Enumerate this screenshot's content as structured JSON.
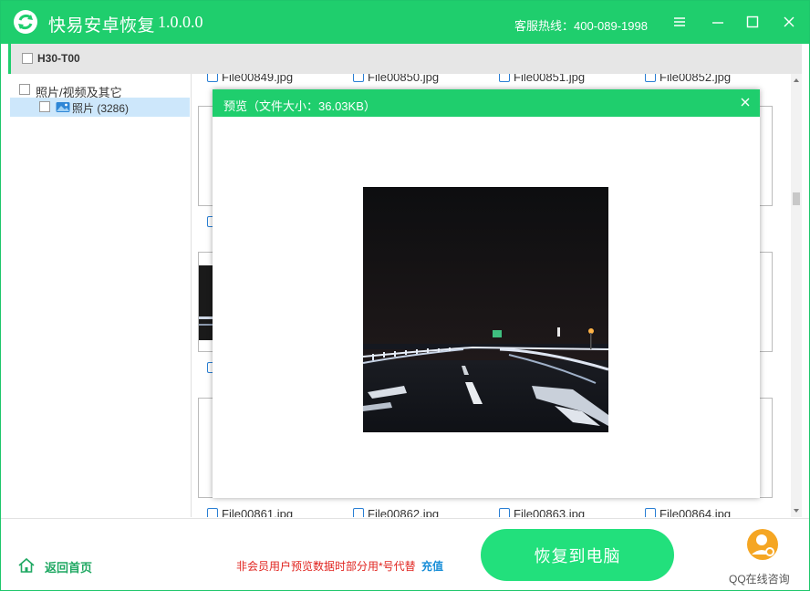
{
  "app": {
    "name": "快易安卓恢复",
    "version": "1.0.0.0",
    "hotline": "客服热线：400-089-1998"
  },
  "colors": {
    "brand": "#1fce6d",
    "button": "#22e07c",
    "notice": "#e0241f",
    "link": "#1a8fd8"
  },
  "device": {
    "name": "H30-T00"
  },
  "tree": {
    "root_label": "照片/视频及其它",
    "child_label": "照片 (3286)"
  },
  "grid": {
    "top_files": [
      "File00849.jpg",
      "File00850.jpg",
      "File00851.jpg",
      "File00852.jpg"
    ],
    "bottom_files": [
      "File00861.jpg",
      "File00862.jpg",
      "File00863.jpg",
      "File00864.jpg"
    ]
  },
  "preview": {
    "title": "预览（文件大小：36.03KB）"
  },
  "bottom": {
    "home_label": "返回首页",
    "notice": "非会员用户预览数据时部分用*号代替",
    "recharge": "充值",
    "recover_button": "恢复到电脑",
    "qq_label": "QQ在线咨询"
  },
  "icons": [
    "app-logo-icon",
    "menu-icon",
    "minimize-icon",
    "maximize-icon",
    "close-icon",
    "photo-folder-icon",
    "home-icon",
    "qq-support-icon"
  ]
}
